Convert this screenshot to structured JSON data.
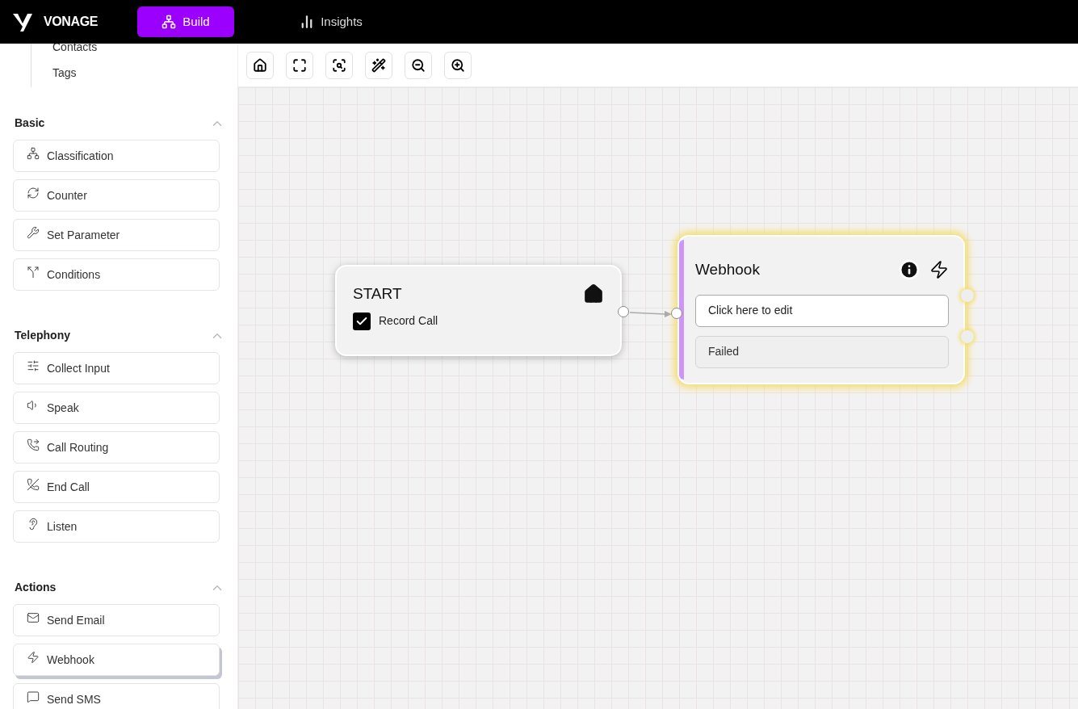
{
  "header": {
    "logo": "VONAGE",
    "tabs": [
      {
        "label": "Build",
        "kind": "build",
        "selected": true
      },
      {
        "label": "Insights",
        "kind": "insights",
        "selected": false
      }
    ]
  },
  "sidebar": {
    "tree_items": [
      "Contacts",
      "Tags"
    ],
    "sections": [
      {
        "title": "Basic",
        "expanded": true,
        "items": [
          {
            "label": "Classification",
            "kind": "classification",
            "selected": false
          },
          {
            "label": "Counter",
            "kind": "counter",
            "selected": false
          },
          {
            "label": "Set Parameter",
            "kind": "parameter",
            "selected": false
          },
          {
            "label": "Conditions",
            "kind": "conditions",
            "selected": false
          }
        ]
      },
      {
        "title": "Telephony",
        "expanded": true,
        "items": [
          {
            "label": "Collect Input",
            "kind": "input",
            "selected": false
          },
          {
            "label": "Speak",
            "kind": "speak",
            "selected": false
          },
          {
            "label": "Call Routing",
            "kind": "routing",
            "selected": false
          },
          {
            "label": "End Call",
            "kind": "endcall",
            "selected": false
          },
          {
            "label": "Listen",
            "kind": "listen",
            "selected": false
          }
        ]
      },
      {
        "title": "Actions",
        "expanded": true,
        "items": [
          {
            "label": "Send Email",
            "kind": "email",
            "selected": false
          },
          {
            "label": "Webhook",
            "kind": "webhook",
            "selected": true
          },
          {
            "label": "Send SMS",
            "kind": "sms",
            "selected": false
          }
        ]
      }
    ]
  },
  "canvas": {
    "start_node": {
      "title": "START",
      "option": {
        "label": "Record Call",
        "checked": true
      }
    },
    "webhook_node": {
      "title": "Webhook",
      "selected": true,
      "field": {
        "value": "Click here to edit"
      },
      "failure_output": "Failed"
    }
  }
}
